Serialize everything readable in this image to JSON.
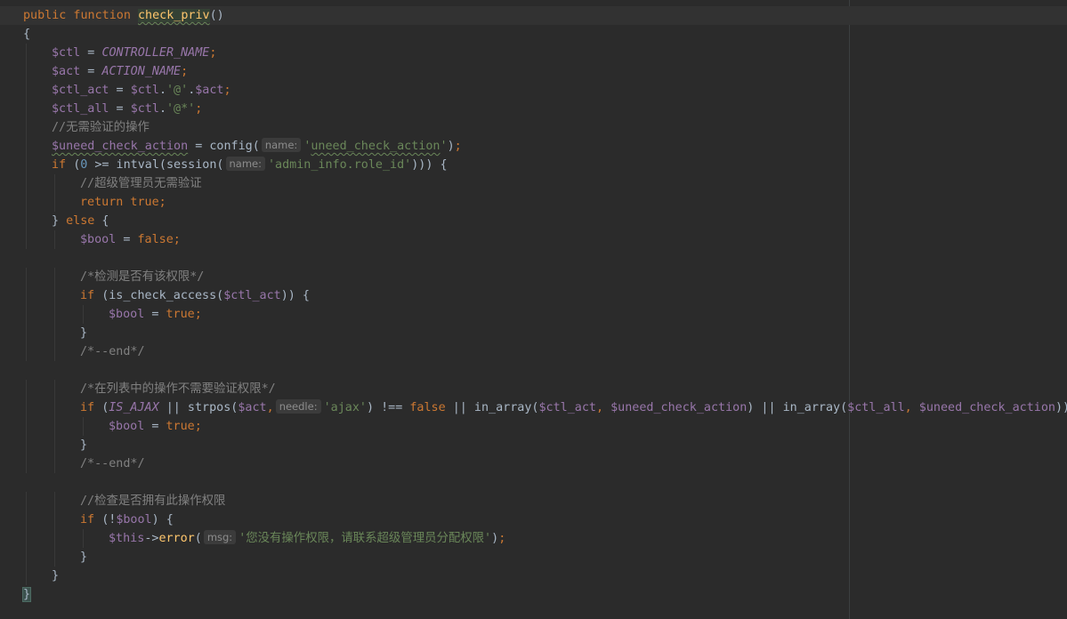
{
  "editor": {
    "lines": [
      [
        [
          "kw",
          "public function "
        ],
        [
          "fndecl",
          "check_priv"
        ],
        [
          "plain",
          "()"
        ]
      ],
      [
        [
          "plain",
          "{"
        ]
      ],
      [
        [
          "var",
          "$ctl"
        ],
        [
          "plain",
          " = "
        ],
        [
          "const",
          "CONTROLLER_NAME"
        ],
        [
          "kw",
          ";"
        ]
      ],
      [
        [
          "var",
          "$act"
        ],
        [
          "plain",
          " = "
        ],
        [
          "const",
          "ACTION_NAME"
        ],
        [
          "kw",
          ";"
        ]
      ],
      [
        [
          "var",
          "$ctl_act"
        ],
        [
          "plain",
          " = "
        ],
        [
          "var",
          "$ctl"
        ],
        [
          "plain",
          "."
        ],
        [
          "str",
          "'@'"
        ],
        [
          "plain",
          "."
        ],
        [
          "var",
          "$act"
        ],
        [
          "kw",
          ";"
        ]
      ],
      [
        [
          "var",
          "$ctl_all"
        ],
        [
          "plain",
          " = "
        ],
        [
          "var",
          "$ctl"
        ],
        [
          "plain",
          "."
        ],
        [
          "str",
          "'@*'"
        ],
        [
          "kw",
          ";"
        ]
      ],
      [
        [
          "cmt",
          "//无需验证的操作"
        ]
      ],
      [
        [
          "varu",
          "$uneed_check_action"
        ],
        [
          "plain",
          " = config("
        ],
        [
          "hint",
          "name:"
        ],
        [
          "str",
          "'"
        ],
        [
          "stru",
          "uneed_check_action"
        ],
        [
          "str",
          "'"
        ],
        [
          "plain",
          ")"
        ],
        [
          "kw",
          ";"
        ]
      ],
      [
        [
          "kw",
          "if "
        ],
        [
          "plain",
          "("
        ],
        [
          "num",
          "0"
        ],
        [
          "plain",
          " >= intval(session("
        ],
        [
          "hint",
          "name:"
        ],
        [
          "str",
          "'admin_info.role_id'"
        ],
        [
          "plain",
          ")))"
        ],
        [
          "plain",
          " {"
        ]
      ],
      [
        [
          "cmt",
          "//超级管理员无需验证"
        ]
      ],
      [
        [
          "kw",
          "return true;"
        ]
      ],
      [
        [
          "plain",
          "} "
        ],
        [
          "kw",
          "else"
        ],
        [
          "plain",
          " {"
        ]
      ],
      [
        [
          "var",
          "$bool"
        ],
        [
          "plain",
          " = "
        ],
        [
          "kw",
          "false;"
        ]
      ],
      [],
      [
        [
          "cmt",
          "/*检测是否有该权限*/"
        ]
      ],
      [
        [
          "kw",
          "if "
        ],
        [
          "plain",
          "(is_check_access("
        ],
        [
          "var",
          "$ctl_act"
        ],
        [
          "plain",
          ")) {"
        ]
      ],
      [
        [
          "var",
          "$bool"
        ],
        [
          "plain",
          " = "
        ],
        [
          "kw",
          "true;"
        ]
      ],
      [
        [
          "plain",
          "}"
        ]
      ],
      [
        [
          "cmt",
          "/*--end*/"
        ]
      ],
      [],
      [
        [
          "cmt",
          "/*在列表中的操作不需要验证权限*/"
        ]
      ],
      [
        [
          "kw",
          "if "
        ],
        [
          "plain",
          "("
        ],
        [
          "const",
          "IS_AJAX"
        ],
        [
          "plain",
          " || strpos("
        ],
        [
          "var",
          "$act"
        ],
        [
          "kw",
          ","
        ],
        [
          "hint",
          "needle:"
        ],
        [
          "str",
          "'ajax'"
        ],
        [
          "plain",
          ") !== "
        ],
        [
          "kw",
          "false"
        ],
        [
          "plain",
          " || in_array("
        ],
        [
          "var",
          "$ctl_act"
        ],
        [
          "kw",
          ", "
        ],
        [
          "var",
          "$uneed_check_action"
        ],
        [
          "plain",
          ") || in_array("
        ],
        [
          "var",
          "$ctl_all"
        ],
        [
          "kw",
          ", "
        ],
        [
          "var",
          "$uneed_check_action"
        ],
        [
          "plain",
          "))"
        ]
      ],
      [
        [
          "var",
          "$bool"
        ],
        [
          "plain",
          " = "
        ],
        [
          "kw",
          "true;"
        ]
      ],
      [
        [
          "plain",
          "}"
        ]
      ],
      [
        [
          "cmt",
          "/*--end*/"
        ]
      ],
      [],
      [
        [
          "cmt",
          "//检查是否拥有此操作权限"
        ]
      ],
      [
        [
          "kw",
          "if "
        ],
        [
          "plain",
          "(!"
        ],
        [
          "var",
          "$bool"
        ],
        [
          "plain",
          ") {"
        ]
      ],
      [
        [
          "var",
          "$this"
        ],
        [
          "plain",
          "->"
        ],
        [
          "method",
          "error"
        ],
        [
          "plain",
          "("
        ],
        [
          "hint",
          "msg:"
        ],
        [
          "str",
          "'您没有操作权限，请联系超级管理员分配权限'"
        ],
        [
          "plain",
          ")"
        ],
        [
          "kw",
          ";"
        ]
      ],
      [
        [
          "plain",
          "}"
        ]
      ],
      [
        [
          "plain",
          "}"
        ]
      ],
      [
        [
          "bracehl",
          "}"
        ]
      ]
    ]
  }
}
